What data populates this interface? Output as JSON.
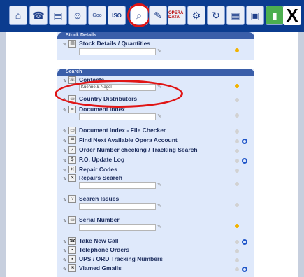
{
  "toolbar": {
    "icons": [
      "home-icon",
      "phone-icon",
      "card-icon",
      "people-icon",
      "google-icon",
      "iso-icon",
      "magnifier-icon",
      "pencil-icon",
      "opera-data-icon",
      "gear-icon",
      "refresh-icon",
      "chart-icon",
      "box-icon",
      "book-icon",
      "close-icon"
    ],
    "labels": {
      "google": "Goo",
      "iso": "ISO",
      "opera": "OPERA DATA"
    }
  },
  "stock": {
    "header": "Stock Details",
    "item": "Stock Details / Quantities"
  },
  "search": {
    "header": "Search",
    "items": [
      {
        "label": "Contacts",
        "value": "Kuehne & Nagel"
      },
      {
        "label": "Country Distributors"
      },
      {
        "label": "Document Index"
      },
      {
        "label": "Document Index - File Checker"
      },
      {
        "label": "Find Next Available Opera Account"
      },
      {
        "label": "Order Number checking / Tracking Search"
      },
      {
        "label": "P.O. Update Log"
      },
      {
        "label": "Repair Codes"
      },
      {
        "label": "Repairs Search"
      },
      {
        "label": "Search Issues"
      },
      {
        "label": "Serial Number"
      },
      {
        "label": "Take New Call"
      },
      {
        "label": "Telephone Orders"
      },
      {
        "label": "UPS / ORD Tracking Numbers"
      },
      {
        "label": "Viamed Gmails"
      }
    ]
  }
}
